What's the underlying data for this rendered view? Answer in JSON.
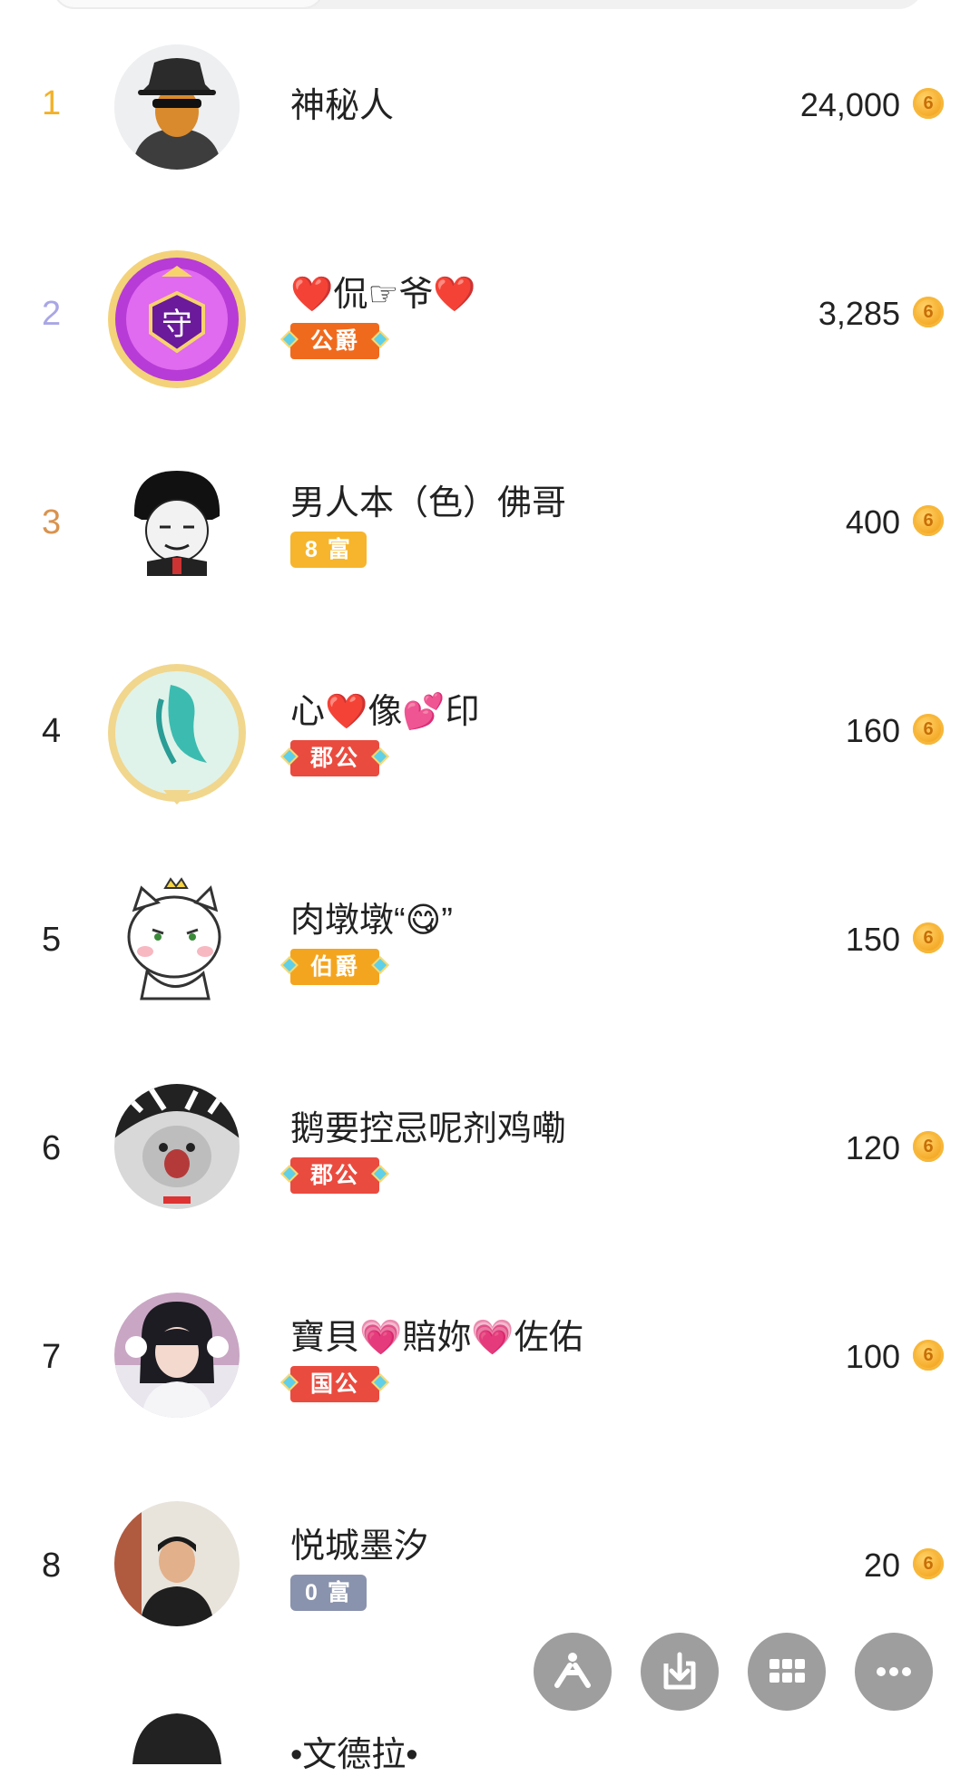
{
  "leaderboard": [
    {
      "rank": "1",
      "name": "神秘人",
      "badge": null,
      "amount": "24,000",
      "rank_color": "#f3b12a"
    },
    {
      "rank": "2",
      "name": "❤️侃☞爷❤️",
      "badge": {
        "label": "公爵",
        "type": "noble",
        "color": "#f06a1d"
      },
      "amount": "3,285",
      "rank_color": "#a9a6e6"
    },
    {
      "rank": "3",
      "name": "男人本（色）佛哥",
      "badge": {
        "label": "8 富",
        "type": "wealth",
        "color": "#f6b52c"
      },
      "amount": "400",
      "rank_color": "#d9934e"
    },
    {
      "rank": "4",
      "name": "心❤️像💕印",
      "badge": {
        "label": "郡公",
        "type": "noble",
        "color": "#ea4b3f"
      },
      "amount": "160",
      "rank_color": "#222222"
    },
    {
      "rank": "5",
      "name": "肉墩墩“😋”",
      "badge": {
        "label": "伯爵",
        "type": "noble",
        "color": "#f4a51f"
      },
      "amount": "150",
      "rank_color": "#222222"
    },
    {
      "rank": "6",
      "name": "鹅要控忌呢剂鸡嘞",
      "badge": {
        "label": "郡公",
        "type": "noble",
        "color": "#ea4b3f"
      },
      "amount": "120",
      "rank_color": "#222222"
    },
    {
      "rank": "7",
      "name": "寶貝💗賠妳💗佐佑",
      "badge": {
        "label": "国公",
        "type": "noble",
        "color": "#ea4b3f"
      },
      "amount": "100",
      "rank_color": "#222222"
    },
    {
      "rank": "8",
      "name": "悦城墨汐",
      "badge": {
        "label": "0 富",
        "type": "wealth",
        "color": "#8a93ad"
      },
      "amount": "20",
      "rank_color": "#222222"
    },
    {
      "rank": "",
      "name": "•文德拉•",
      "badge": null,
      "amount": "",
      "rank_color": "#222222"
    }
  ],
  "floating_actions": [
    {
      "icon": "share-icon"
    },
    {
      "icon": "download-icon"
    },
    {
      "icon": "grid-icon"
    },
    {
      "icon": "more-icon"
    }
  ],
  "colors": {
    "coin": "#f4a622",
    "fab": "#9e9e9e"
  }
}
